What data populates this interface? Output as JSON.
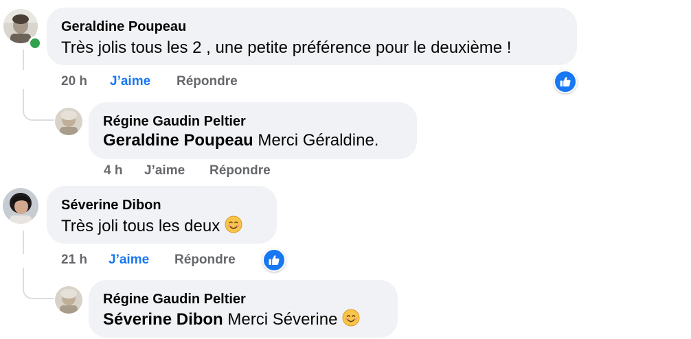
{
  "comments": [
    {
      "author": "Geraldine Poupeau",
      "text": "Très jolis tous les 2 , une petite préférence pour le deuxième !",
      "time": "20 h",
      "like_label": "J’aime",
      "reply_label": "Répondre",
      "liked": true,
      "online": true,
      "reaction_icon": "like-reaction-icon",
      "replies": [
        {
          "author": "Régine Gaudin Peltier",
          "mention": "Geraldine Poupeau",
          "text": "Merci Géraldine.",
          "time": "4 h",
          "like_label": "J’aime",
          "reply_label": "Répondre",
          "liked": false
        }
      ]
    },
    {
      "author": "Séverine Dibon",
      "text": "Très joli tous les deux",
      "text_emoji": "smiling-face-icon",
      "time": "21 h",
      "like_label": "J’aime",
      "reply_label": "Répondre",
      "liked": true,
      "reaction_icon": "like-reaction-icon",
      "replies": [
        {
          "author": "Régine Gaudin Peltier",
          "mention": "Séverine Dibon",
          "text": "Merci Séverine",
          "text_emoji": "smiling-face-icon",
          "time": "",
          "like_label": "",
          "reply_label": "",
          "liked": false
        }
      ]
    }
  ],
  "colors": {
    "bubble": "#f0f2f5",
    "liked": "#1877f2",
    "meta": "#65676b",
    "online": "#31a24c",
    "thread_line": "#dadde1"
  }
}
